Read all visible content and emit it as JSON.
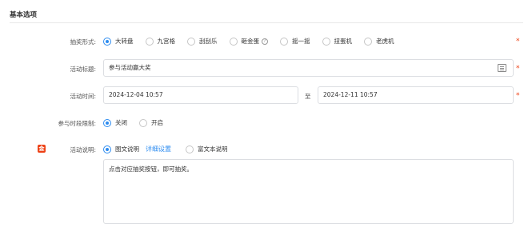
{
  "section": {
    "title": "基本选项"
  },
  "lottery_form": {
    "label": "抽奖形式:",
    "options": [
      {
        "label": "大转盘",
        "checked": true
      },
      {
        "label": "九宫格",
        "checked": false
      },
      {
        "label": "刮刮乐",
        "checked": false
      },
      {
        "label": "砸金蛋",
        "checked": false,
        "help": "?"
      },
      {
        "label": "摇一摇",
        "checked": false
      },
      {
        "label": "扭蛋机",
        "checked": false
      },
      {
        "label": "老虎机",
        "checked": false
      }
    ],
    "required": "*"
  },
  "activity_title": {
    "label": "活动标题:",
    "value": "参与活动赢大奖",
    "required": "*",
    "icon": "list-icon"
  },
  "activity_time": {
    "label": "活动时间:",
    "start": "2024-12-04 10:57",
    "separator": "至",
    "end": "2024-12-11 10:57",
    "required": "*"
  },
  "participation_limit": {
    "label": "参与时段限制:",
    "options": [
      {
        "label": "关闭",
        "checked": true
      },
      {
        "label": "开启",
        "checked": false
      }
    ]
  },
  "activity_desc": {
    "label": "活动说明:",
    "badge": "金",
    "option_image_text": "图文说明",
    "link": "详细设置",
    "option_rich_text": "富文本说明",
    "text": "点击对应抽奖按钮，即可抽奖。"
  },
  "colors": {
    "primary": "#2d8cf0",
    "required": "#ed4014",
    "badge": "#ed4014"
  }
}
